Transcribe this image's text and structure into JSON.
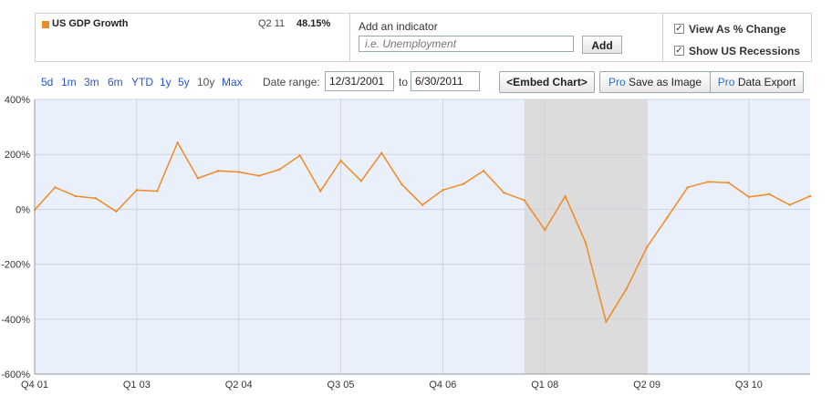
{
  "header": {
    "series_name": "US GDP Growth",
    "series_period": "Q2 11",
    "series_value": "48.15%",
    "series_color": "#f08a24",
    "indicator_label": "Add an indicator",
    "indicator_placeholder": "i.e. Unemployment",
    "add_label": "Add",
    "view_as_change_label": "View As % Change",
    "view_as_change_checked": true,
    "show_recessions_label": "Show US Recessions",
    "show_recessions_checked": true
  },
  "toolbar": {
    "ranges": [
      "5d",
      "1m",
      "3m",
      "6m",
      "YTD",
      "1y",
      "5y",
      "10y",
      "Max"
    ],
    "selected_range": "10y",
    "date_range_label": "Date range:",
    "start_date": "12/31/2001",
    "to_label": "to",
    "end_date": "6/30/2011",
    "embed_label": "<Embed Chart>",
    "pro_label": "Pro",
    "save_image_label": "Save as Image",
    "data_export_label": "Data Export"
  },
  "chart_data": {
    "type": "line",
    "title": "",
    "xlabel": "",
    "ylabel": "",
    "ylim": [
      -600,
      400
    ],
    "yticks": [
      400,
      200,
      0,
      -200,
      -400,
      -600
    ],
    "ytick_labels": [
      "400%",
      "200%",
      "0%",
      "-200%",
      "-400%",
      "-600%"
    ],
    "grid": true,
    "background_color": "#eaf0fb",
    "line_color": "#f08a24",
    "recession_color": "#dcdcdc",
    "x_quarter_range": [
      "Q4 01",
      "Q2 11"
    ],
    "xtick_labels": [
      "Q4 01",
      "Q1 03",
      "Q2 04",
      "Q3 05",
      "Q4 06",
      "Q1 08",
      "Q2 09",
      "Q3 10"
    ],
    "recessions": [
      {
        "start": "Q4 07",
        "end": "Q2 09"
      }
    ],
    "series": [
      {
        "name": "US GDP Growth",
        "x": [
          "Q4 01",
          "Q1 02",
          "Q2 02",
          "Q3 02",
          "Q4 02",
          "Q1 03",
          "Q2 03",
          "Q3 03",
          "Q4 03",
          "Q1 04",
          "Q2 04",
          "Q3 04",
          "Q4 04",
          "Q1 05",
          "Q2 05",
          "Q3 05",
          "Q4 05",
          "Q1 06",
          "Q2 06",
          "Q3 06",
          "Q4 06",
          "Q1 07",
          "Q2 07",
          "Q3 07",
          "Q4 07",
          "Q1 08",
          "Q2 08",
          "Q3 08",
          "Q4 08",
          "Q1 09",
          "Q2 09",
          "Q3 09",
          "Q4 09",
          "Q1 10",
          "Q2 10",
          "Q3 10",
          "Q4 10",
          "Q1 11",
          "Q2 11"
        ],
        "values": [
          -2,
          80,
          48,
          40,
          -8,
          70,
          66,
          243,
          113,
          140,
          136,
          122,
          145,
          196,
          66,
          177,
          103,
          205,
          90,
          16,
          70,
          92,
          140,
          60,
          33,
          -75,
          48,
          -122,
          -410,
          -290,
          -138,
          -30,
          80,
          100,
          97,
          45,
          55,
          16,
          48
        ]
      }
    ]
  }
}
